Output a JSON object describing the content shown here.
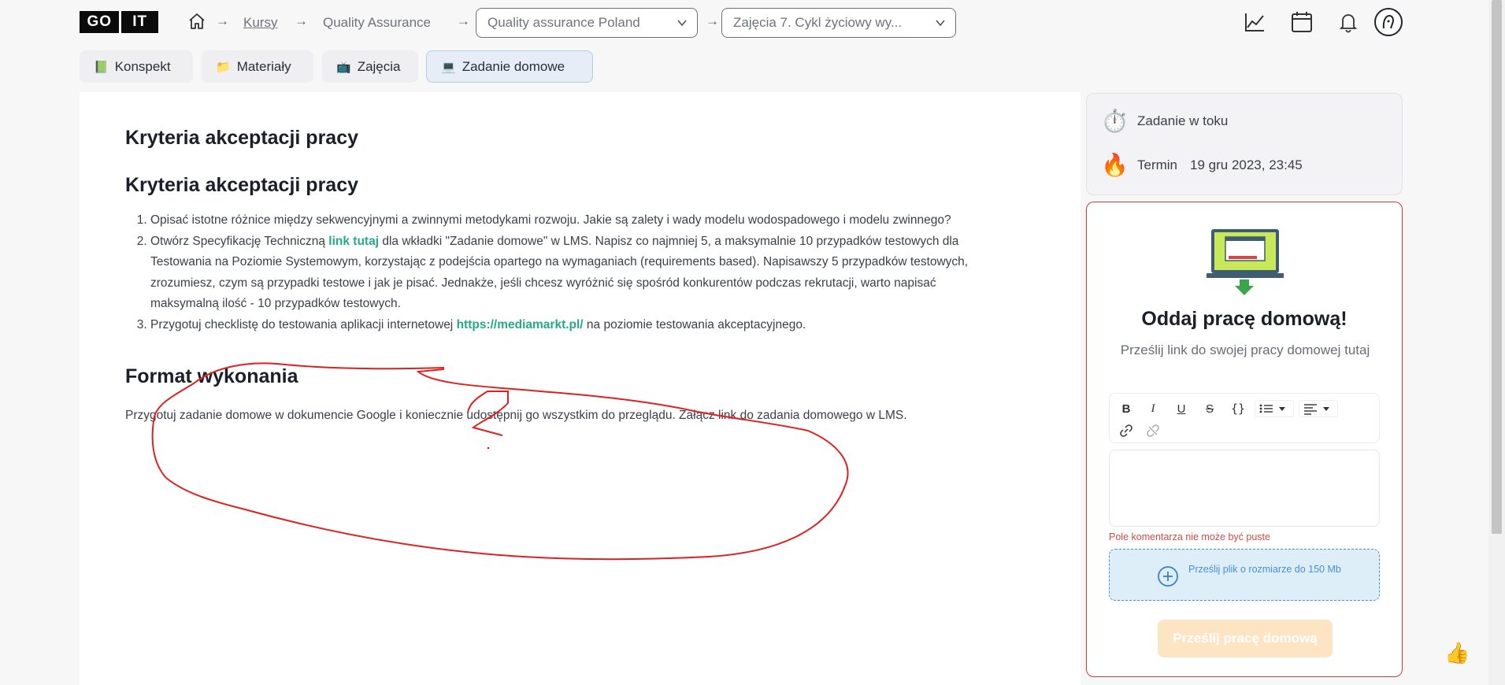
{
  "header": {
    "logo_go": "GO",
    "logo_it": "IT",
    "breadcrumb": {
      "courses": "Kursy",
      "course": "Quality Assurance",
      "group_select": "Quality assurance Poland",
      "lesson_select": "Zajęcia 7. Cykl życiowy wy..."
    },
    "icons": [
      "home-icon",
      "chart-icon",
      "calendar-icon",
      "bell-icon",
      "avatar"
    ]
  },
  "tabs": [
    {
      "emoji": "📗",
      "label": "Konspekt"
    },
    {
      "emoji": "📁",
      "label": "Materiały"
    },
    {
      "emoji": "📺",
      "label": "Zajęcia"
    },
    {
      "emoji": "💻",
      "label": "Zadanie domowe"
    }
  ],
  "content": {
    "heading1": "Kryteria akceptacji pracy",
    "heading2": "Kryteria akceptacji pracy",
    "item1": "Opisać istotne różnice między sekwencyjnymi a zwinnymi metodykami rozwoju. Jakie są zalety i wady modelu wodospadowego i modelu zwinnego?",
    "item2_pre": "Otwórz Specyfikację Techniczną ",
    "item2_link": "link tutaj",
    "item2_post": " dla wkładki \"Zadanie domowe\" w LMS. Napisz co najmniej 5, a maksymalnie 10 przypadków testowych dla Testowania na Poziomie Systemowym, korzystając z podejścia opartego na wymaganiach (requirements based). Napisawszy 5 przypadków testowych, zrozumiesz, czym są przypadki testowe i jak je pisać. Jednakże, jeśli chcesz wyróżnić się spośród konkurentów podczas rekrutacji, warto napisać maksymalną ilość - 10 przypadków testowych.",
    "item3_pre": "Przygotuj checklistę do testowania aplikacji internetowej ",
    "item3_link": "https://mediamarkt.pl/",
    "item3_post": " na poziomie testowania akceptacyjnego.",
    "heading3": "Format wykonania",
    "paragraph": "Przygotuj zadanie domowe w dokumencie Google i koniecznie udostępnij go wszystkim do przeglądu. Załącz link do zadania domowego w LMS."
  },
  "sidebar": {
    "status_label": "Zadanie w toku",
    "deadline_label": "Termin",
    "deadline_value": "19 gru 2023, 23:45",
    "submit_title": "Oddaj pracę domową!",
    "submit_subtitle": "Prześlij link do swojej pracy domowej tutaj",
    "toolbar": [
      "B",
      "I",
      "U",
      "S",
      "{}"
    ],
    "error": "Pole komentarza nie może być puste",
    "upload_text": "Prześlij plik o rozmiarze do 150 Mb",
    "submit_button": "Prześlij pracę domową"
  },
  "colors": {
    "accent_link": "#24a98c",
    "error_red": "#d34a4a",
    "upload_blue": "#4a8fd6",
    "submit_disabled": "#fde4c3"
  }
}
